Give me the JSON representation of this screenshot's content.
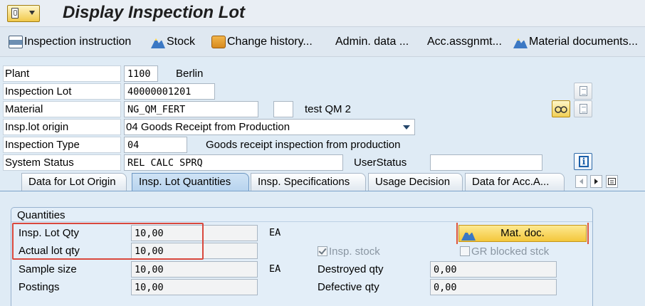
{
  "window": {
    "title": "Display Inspection Lot"
  },
  "toolbar": {
    "inspection_instruction": "Inspection instruction",
    "stock": "Stock",
    "change_history": "Change history...",
    "admin_data": "Admin. data ...",
    "acc_assignment": "Acc.assgnmt...",
    "material_documents": "Material documents..."
  },
  "header": {
    "plant": {
      "label": "Plant",
      "value": "1100",
      "text": "Berlin"
    },
    "inspection_lot": {
      "label": "Inspection Lot",
      "value": "40000001201"
    },
    "material": {
      "label": "Material",
      "value": "NG_QM_FERT",
      "text": "test QM 2"
    },
    "insp_lot_origin": {
      "label": "Insp.lot origin",
      "value": "04 Goods Receipt from Production"
    },
    "inspection_type": {
      "label": "Inspection Type",
      "value": "04",
      "text": "Goods receipt inspection from production"
    },
    "system_status": {
      "label": "System Status",
      "value": "REL  CALC SPRQ"
    },
    "user_status": {
      "label": "UserStatus",
      "value": ""
    }
  },
  "tabs": [
    {
      "label": "Data for Lot Origin",
      "active": false
    },
    {
      "label": "Insp. Lot Quantities",
      "active": true
    },
    {
      "label": "Insp. Specifications",
      "active": false
    },
    {
      "label": "Usage Decision",
      "active": false
    },
    {
      "label": "Data for Acc.A...",
      "active": false
    }
  ],
  "quantities": {
    "group_title": "Quantities",
    "insp_lot_qty": {
      "label": "Insp. Lot Qty",
      "value": "10,00",
      "unit": "EA"
    },
    "actual_lot_qty": {
      "label": "Actual lot qty",
      "value": "10,00"
    },
    "sample_size": {
      "label": "Sample size",
      "value": "10,00",
      "unit": "EA"
    },
    "postings": {
      "label": "Postings",
      "value": "10,00"
    },
    "mat_doc_button": "Mat. doc.",
    "insp_stock": {
      "label": "Insp. stock",
      "checked": true
    },
    "gr_blocked_stock": {
      "label": "GR blocked stck",
      "checked": false
    },
    "destroyed_qty": {
      "label": "Destroyed qty",
      "value": "0,00"
    },
    "defective_qty": {
      "label": "Defective qty",
      "value": "0,00"
    }
  },
  "colors": {
    "highlight_box": "#d9483d",
    "active_tab": "#b7d3ee",
    "mat_doc_button": "#f4c73b"
  }
}
